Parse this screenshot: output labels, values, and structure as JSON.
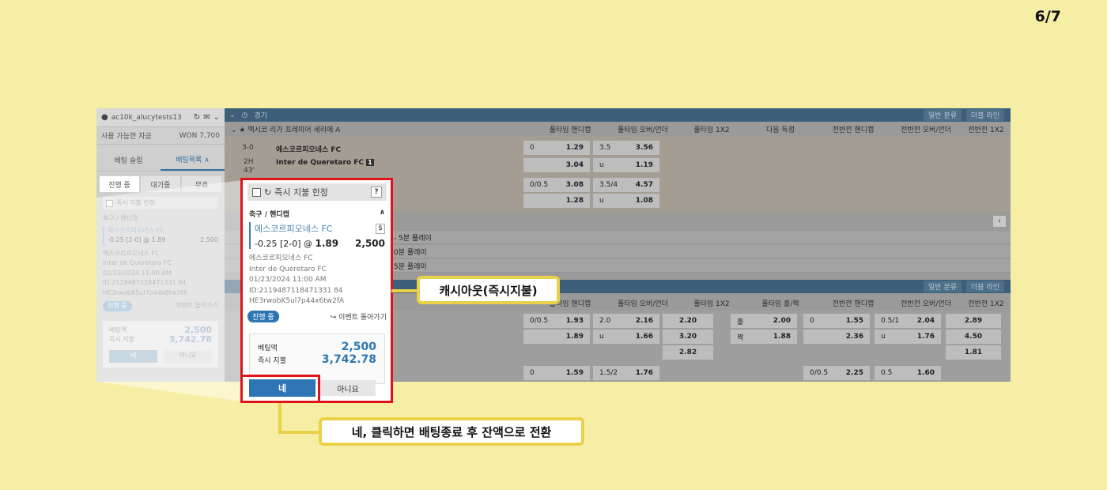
{
  "page_number": "6/7",
  "sidebar": {
    "username": "ac10k_alucytests13",
    "balance_label": "사용 가능한 자금",
    "balance_value": "WON 7,700",
    "tabs": [
      "베팅 슬립",
      "베팅목록 ∧"
    ],
    "subtabs": [
      "진행 중",
      "대기중",
      "무효"
    ],
    "cashout_label": "즉시 지불 한정",
    "category": "축구 / 핸디캡",
    "team": "에스코르피오네스 FC",
    "odds_line": "-0.25 [2-0] @ 1.89",
    "stake": "2,500",
    "home": "에스코르피오네스 FC",
    "away": "Inter de Queretaro FC",
    "datetime": "01/23/2024 11:00 AM",
    "bet_id": "ID:2119487118471331 84",
    "hash": "HE3rwobK5ul7p44x6tw2fA",
    "status": "진행 중",
    "back_link": "이벤트 돌아가기",
    "bet_amount_label": "베팅액",
    "bet_amount": "2,500",
    "payout_label": "즉시 지불",
    "payout": "3,742.78",
    "yes": "네",
    "no": "아니요"
  },
  "main": {
    "top_bar_title": "경기",
    "filter_chip": "일반 분류",
    "line_chip": "더블 라인",
    "league": "멕시코 리가 프레미어 세리에 A",
    "columns": [
      "풀타임 핸디캡",
      "풀타임 오버/언더",
      "풀타임 1X2",
      "다음 득점",
      "전반전 핸디캡",
      "전반전 오버/언더",
      "전반전 1X2"
    ],
    "columns2": [
      "풀타임 핸디캡",
      "풀타임 오버/언더",
      "풀타임 1X2",
      "풀타임 홀/짝",
      "전반전 핸디캡",
      "전반전 오버/언더",
      "전반전 1X2"
    ],
    "match": {
      "score": "3-0",
      "period": "2H",
      "minute": "43'",
      "home": "에스코르피오네스 FC",
      "away": "Inter de Queretaro FC",
      "red_card": "1"
    },
    "odds_rows_1": [
      {
        "hdp": "0",
        "hdp_odds": "1.29",
        "ou": "3.5",
        "ou_odds": "3.56"
      },
      {
        "hdp": "",
        "hdp_odds": "3.04",
        "ou": "u",
        "ou_odds": "1.19"
      },
      {
        "hdp": "0/0.5",
        "hdp_odds": "3.08",
        "ou": "3.5/4",
        "ou_odds": "4.57"
      },
      {
        "hdp": "",
        "hdp_odds": "1.28",
        "ou": "u",
        "ou_odds": "1.08"
      }
    ],
    "play_rows": [
      "- 5분 플레이",
      "0분 플레이",
      "5분 플레이"
    ],
    "odds_rows_2": [
      {
        "hdp": "0/0.5",
        "hdp_odds": "1.93",
        "ou": "2.0",
        "ou_odds": "2.16",
        "x12": "2.20",
        "oe": "홀",
        "oe_odds": "2.00",
        "h_hdp": "0",
        "h_hdp_odds": "1.55",
        "h_ou": "0.5/1",
        "h_ou_odds": "2.04",
        "h_x12": "2.89"
      },
      {
        "hdp": "",
        "hdp_odds": "1.89",
        "ou": "u",
        "ou_odds": "1.66",
        "x12": "3.20",
        "oe": "짝",
        "oe_odds": "1.88",
        "h_hdp": "",
        "h_hdp_odds": "2.36",
        "h_ou": "u",
        "h_ou_odds": "1.76",
        "h_x12": "4.50"
      },
      {
        "hdp": "",
        "hdp_odds": "",
        "ou": "",
        "ou_odds": "",
        "x12": "2.82",
        "oe": "",
        "oe_odds": "",
        "h_hdp": "",
        "h_hdp_odds": "",
        "h_ou": "",
        "h_ou_odds": "",
        "h_x12": "1.81"
      },
      {
        "hdp": "0",
        "hdp_odds": "1.59",
        "ou": "1.5/2",
        "ou_odds": "1.76",
        "x12": "",
        "oe": "",
        "oe_odds": "",
        "h_hdp": "0/0.5",
        "h_hdp_odds": "2.25",
        "h_ou": "0.5",
        "h_ou_odds": "1.60",
        "h_x12": ""
      }
    ]
  },
  "zoom_slip": {
    "cashout_label": "즉시 지불 한정",
    "help": "?",
    "category": "축구 / 핸디캡",
    "team": "에스코르피오네스 FC",
    "odds_line": "-0.25 [2-0] @",
    "odds": "1.89",
    "stake": "2,500",
    "home": "에스코르피오네스 FC",
    "away": "Inter de Queretaro FC",
    "datetime": "01/23/2024 11:00 AM",
    "bet_id": "ID:2119487118471331 84",
    "hash": "HE3rwobK5ul7p44x6tw2fA",
    "status": "진행 중",
    "back_link": "이벤트 돌아가기",
    "bet_amount_label": "베팅액",
    "bet_amount": "2,500",
    "payout_label": "즉시 지불",
    "payout": "3,742.78",
    "yes": "네",
    "no": "아니요"
  },
  "callouts": {
    "cashout": "캐시아웃(즉시지불)",
    "confirm": "네, 클릭하면 배팅종료 후 잔액으로 전환"
  },
  "colors": {
    "background": "#f7eea6",
    "highlight_red": "#e0131a",
    "callout_yellow": "#e9d24a",
    "accent_blue": "#2d76b3"
  }
}
